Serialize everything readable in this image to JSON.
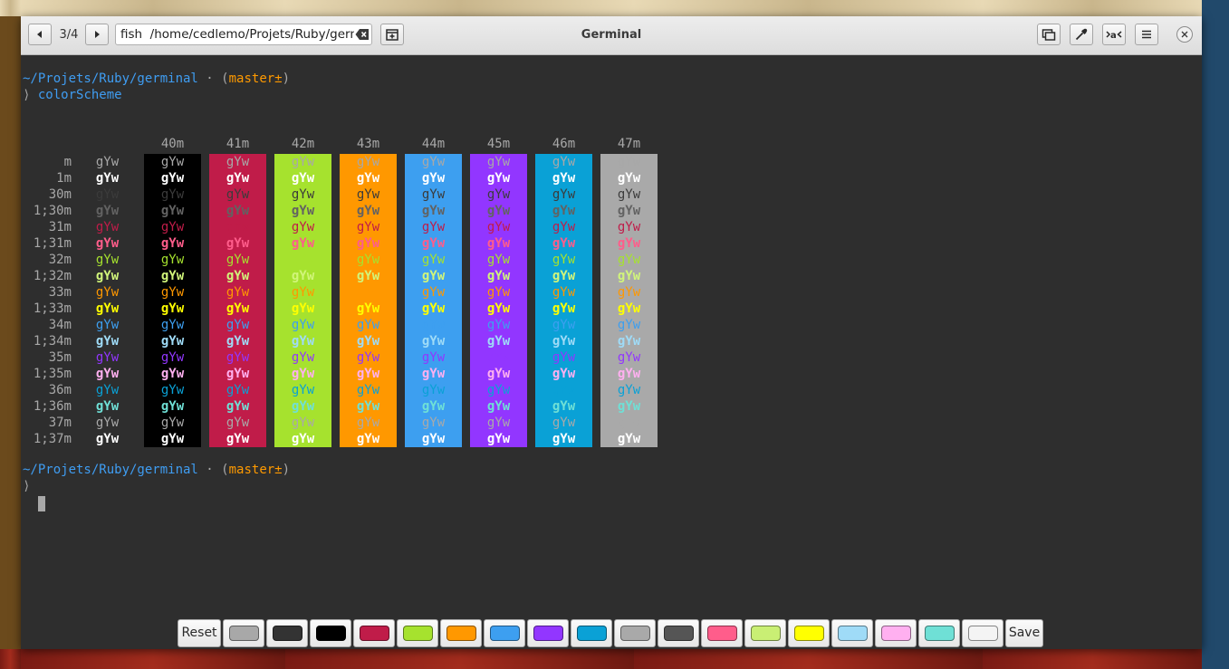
{
  "window": {
    "title": "Germinal"
  },
  "toolbar": {
    "page_counter": "3/4",
    "path": "fish  /home/cedlemo/Projets/Ruby/germinal",
    "buttons": [
      "prev-terminal",
      "next-terminal",
      "new-tab",
      "overview",
      "color-picker",
      "font-selector",
      "menu",
      "close"
    ]
  },
  "terminal": {
    "prompt_path": "~/Projets/Ruby/germinal",
    "prompt_separator": " · ",
    "prompt_branch_open": "(",
    "prompt_branch": "master±",
    "prompt_branch_close": ")",
    "prompt_symbol": "⟩",
    "command": "colorScheme",
    "sample_text": "gYw",
    "column_headers": [
      "40m",
      "41m",
      "42m",
      "43m",
      "44m",
      "45m",
      "46m",
      "47m"
    ],
    "row_labels": [
      "m",
      "1m",
      "30m",
      "1;30m",
      "31m",
      "1;31m",
      "32m",
      "1;32m",
      "33m",
      "1;33m",
      "34m",
      "1;34m",
      "35m",
      "1;35m",
      "36m",
      "1;36m",
      "37m",
      "1;37m"
    ],
    "background_colors": [
      "#000000",
      "#c01c49",
      "#a6e22e",
      "#ff9800",
      "#3d9ff0",
      "#9236ff",
      "#0aa1d6",
      "#a9a9a9"
    ],
    "foreground_colors": {
      "default": "#a8a8a8",
      "default_bold": "#ffffff",
      "30": "#3b3b3b",
      "1;30": "#626262",
      "31": "#c01c49",
      "1;31": "#ff5d8b",
      "32": "#a6e22e",
      "1;32": "#d1f57a",
      "33": "#ff9800",
      "1;33": "#ffff00",
      "34": "#3d9ff0",
      "1;34": "#9fdbf7",
      "35": "#9236ff",
      "1;35": "#ffb0f0",
      "36": "#0aa1d6",
      "1;36": "#6fe0d6",
      "37": "#a9a9a9",
      "1;37": "#ffffff"
    }
  },
  "palette": {
    "reset_label": "Reset",
    "save_label": "Save",
    "swatches": [
      "#a8a8a8",
      "#333333",
      "#000000",
      "#c01c49",
      "#a6e22e",
      "#ff9800",
      "#3d9ff0",
      "#9236ff",
      "#0aa1d6",
      "#a9a9a9",
      "#555555",
      "#ff5d8b",
      "#c9ef74",
      "#ffff00",
      "#9fdbf7",
      "#ffb0f0",
      "#6fe0d6",
      "#f4f4f4"
    ]
  }
}
